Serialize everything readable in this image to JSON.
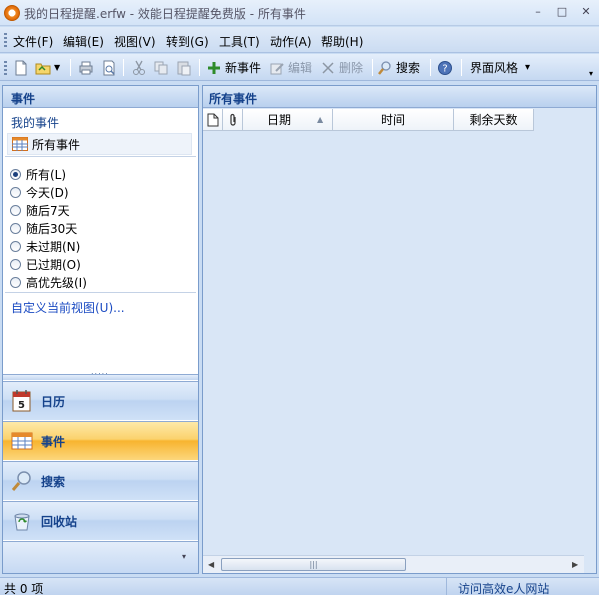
{
  "window": {
    "title": "我的日程提醒.erfw - 效能日程提醒免费版 - 所有事件",
    "minimize": "–",
    "maximize": "□",
    "close": "✕"
  },
  "menu": [
    "文件(F)",
    "编辑(E)",
    "视图(V)",
    "转到(G)",
    "工具(T)",
    "动作(A)",
    "帮助(H)"
  ],
  "toolbar": {
    "new_event": "新事件",
    "edit": "编辑",
    "delete": "删除",
    "search": "搜索",
    "theme": "界面风格",
    "theme_arrow": "▾"
  },
  "left": {
    "header": "事件",
    "subheader": "我的事件",
    "selected_view": "所有事件",
    "filters": [
      {
        "label": "所有(L)",
        "checked": true
      },
      {
        "label": "今天(D)",
        "checked": false
      },
      {
        "label": "随后7天",
        "checked": false
      },
      {
        "label": "随后30天",
        "checked": false
      },
      {
        "label": "未过期(N)",
        "checked": false
      },
      {
        "label": "已过期(O)",
        "checked": false
      },
      {
        "label": "高优先级(I)",
        "checked": false
      }
    ],
    "customize_link": "自定义当前视图(U)...",
    "nav": [
      {
        "label": "日历",
        "icon": "calendar-icon",
        "active": false
      },
      {
        "label": "事件",
        "icon": "event-list-icon",
        "active": true
      },
      {
        "label": "搜索",
        "icon": "search-icon",
        "active": false
      },
      {
        "label": "回收站",
        "icon": "recycle-bin-icon",
        "active": false
      }
    ]
  },
  "right": {
    "header": "所有事件",
    "columns": {
      "date": "日期",
      "time": "时间",
      "remaining_days": "剩余天数"
    },
    "scroll_grip": "|||"
  },
  "status": {
    "count": "共 0 项",
    "link": "访问高效e人网站"
  },
  "colors": {
    "accent": "#15428b",
    "active_nav": "#f8b42f",
    "background": "#c9dcf3"
  }
}
